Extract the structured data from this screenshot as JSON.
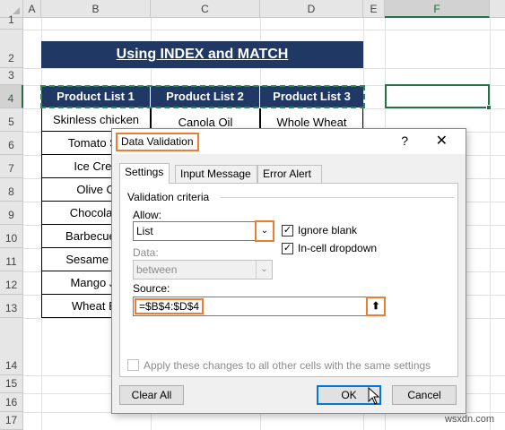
{
  "columns": [
    "A",
    "B",
    "C",
    "D",
    "E",
    "F"
  ],
  "selected_column": "F",
  "rows": [
    "1",
    "2",
    "3",
    "4",
    "5",
    "6",
    "7",
    "8",
    "9",
    "10",
    "11",
    "12",
    "13",
    "14",
    "15",
    "16",
    "17"
  ],
  "selected_row": "4",
  "title": "Using INDEX and MATCH",
  "headers": [
    "Product List 1",
    "Product List 2",
    "Product List 3"
  ],
  "col_b": [
    "Skinless chicken",
    "Tomato Sa",
    "Ice Crea",
    "Olive O",
    "Chocolate",
    "Barbecue S",
    "Sesame Se",
    "Mango Ju",
    "Wheat Br"
  ],
  "col_c": [
    "Canola Oil"
  ],
  "col_d": [
    "Whole Wheat"
  ],
  "dialog": {
    "title": "Data Validation",
    "help": "?",
    "close": "✕",
    "tabs": [
      "Settings",
      "Input Message",
      "Error Alert"
    ],
    "criteria_label": "Validation criteria",
    "allow_label": "Allow:",
    "allow_value": "List",
    "ignore_blank": "Ignore blank",
    "in_cell_dropdown": "In-cell dropdown",
    "data_label": "Data:",
    "data_value": "between",
    "source_label": "Source:",
    "source_value": "=$B$4:$D$4",
    "apply_all": "Apply these changes to all other cells with the same settings",
    "clear_all": "Clear All",
    "ok": "OK",
    "cancel": "Cancel"
  },
  "watermark": "wsxdn.com",
  "colors": {
    "header_fill": "#203864",
    "accent_orange": "#ed7d31",
    "excel_green": "#217346"
  },
  "icons": [
    "dropdown-arrow-icon",
    "collapse-dialog-icon",
    "close-icon",
    "help-icon",
    "mouse-pointer-icon"
  ]
}
